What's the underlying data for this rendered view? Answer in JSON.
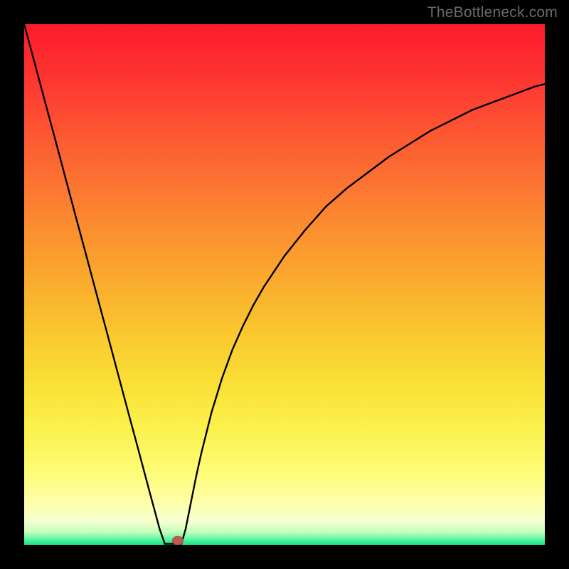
{
  "watermark": "TheBottleneck.com",
  "colors": {
    "frame": "#000000",
    "curve": "#000000",
    "marker_fill": "#c0594f",
    "marker_stroke": "#a8473f",
    "gradient_stops": [
      {
        "offset": 0.0,
        "color": "#fd1b2c"
      },
      {
        "offset": 0.1,
        "color": "#fd3430"
      },
      {
        "offset": 0.2,
        "color": "#fd5432"
      },
      {
        "offset": 0.3,
        "color": "#fc7232"
      },
      {
        "offset": 0.4,
        "color": "#fb902f"
      },
      {
        "offset": 0.5,
        "color": "#faad2e"
      },
      {
        "offset": 0.6,
        "color": "#fac92f"
      },
      {
        "offset": 0.7,
        "color": "#fae238"
      },
      {
        "offset": 0.78,
        "color": "#fbf24e"
      },
      {
        "offset": 0.86,
        "color": "#fefc78"
      },
      {
        "offset": 0.92,
        "color": "#ffffaa"
      },
      {
        "offset": 0.955,
        "color": "#f5ffd0"
      },
      {
        "offset": 0.975,
        "color": "#c7ffbf"
      },
      {
        "offset": 0.988,
        "color": "#66f7a2"
      },
      {
        "offset": 1.0,
        "color": "#0fe489"
      }
    ]
  },
  "chart_data": {
    "type": "line",
    "title": "",
    "xlabel": "",
    "ylabel": "",
    "xlim": [
      0,
      1
    ],
    "ylim": [
      0,
      1
    ],
    "x": [
      0.0,
      0.02,
      0.04,
      0.06,
      0.08,
      0.1,
      0.12,
      0.14,
      0.16,
      0.18,
      0.2,
      0.22,
      0.24,
      0.26,
      0.27,
      0.28,
      0.285,
      0.29,
      0.295,
      0.3,
      0.31,
      0.32,
      0.33,
      0.34,
      0.35,
      0.36,
      0.38,
      0.4,
      0.42,
      0.44,
      0.46,
      0.48,
      0.5,
      0.54,
      0.58,
      0.62,
      0.66,
      0.7,
      0.74,
      0.78,
      0.82,
      0.86,
      0.9,
      0.94,
      0.98,
      1.0
    ],
    "values": [
      1.0,
      0.926,
      0.851,
      0.777,
      0.702,
      0.627,
      0.553,
      0.478,
      0.404,
      0.329,
      0.254,
      0.18,
      0.105,
      0.031,
      0.01,
      0.003,
      0.001,
      0.001,
      0.001,
      0.001,
      0.03,
      0.08,
      0.13,
      0.175,
      0.215,
      0.255,
      0.32,
      0.375,
      0.42,
      0.46,
      0.495,
      0.525,
      0.555,
      0.605,
      0.65,
      0.685,
      0.715,
      0.745,
      0.77,
      0.795,
      0.815,
      0.835,
      0.85,
      0.865,
      0.88,
      0.885
    ],
    "marker": {
      "x": 0.295,
      "y": 0.008
    },
    "flat_bottom": {
      "x_start": 0.27,
      "x_end": 0.302,
      "y": 0.002
    }
  }
}
